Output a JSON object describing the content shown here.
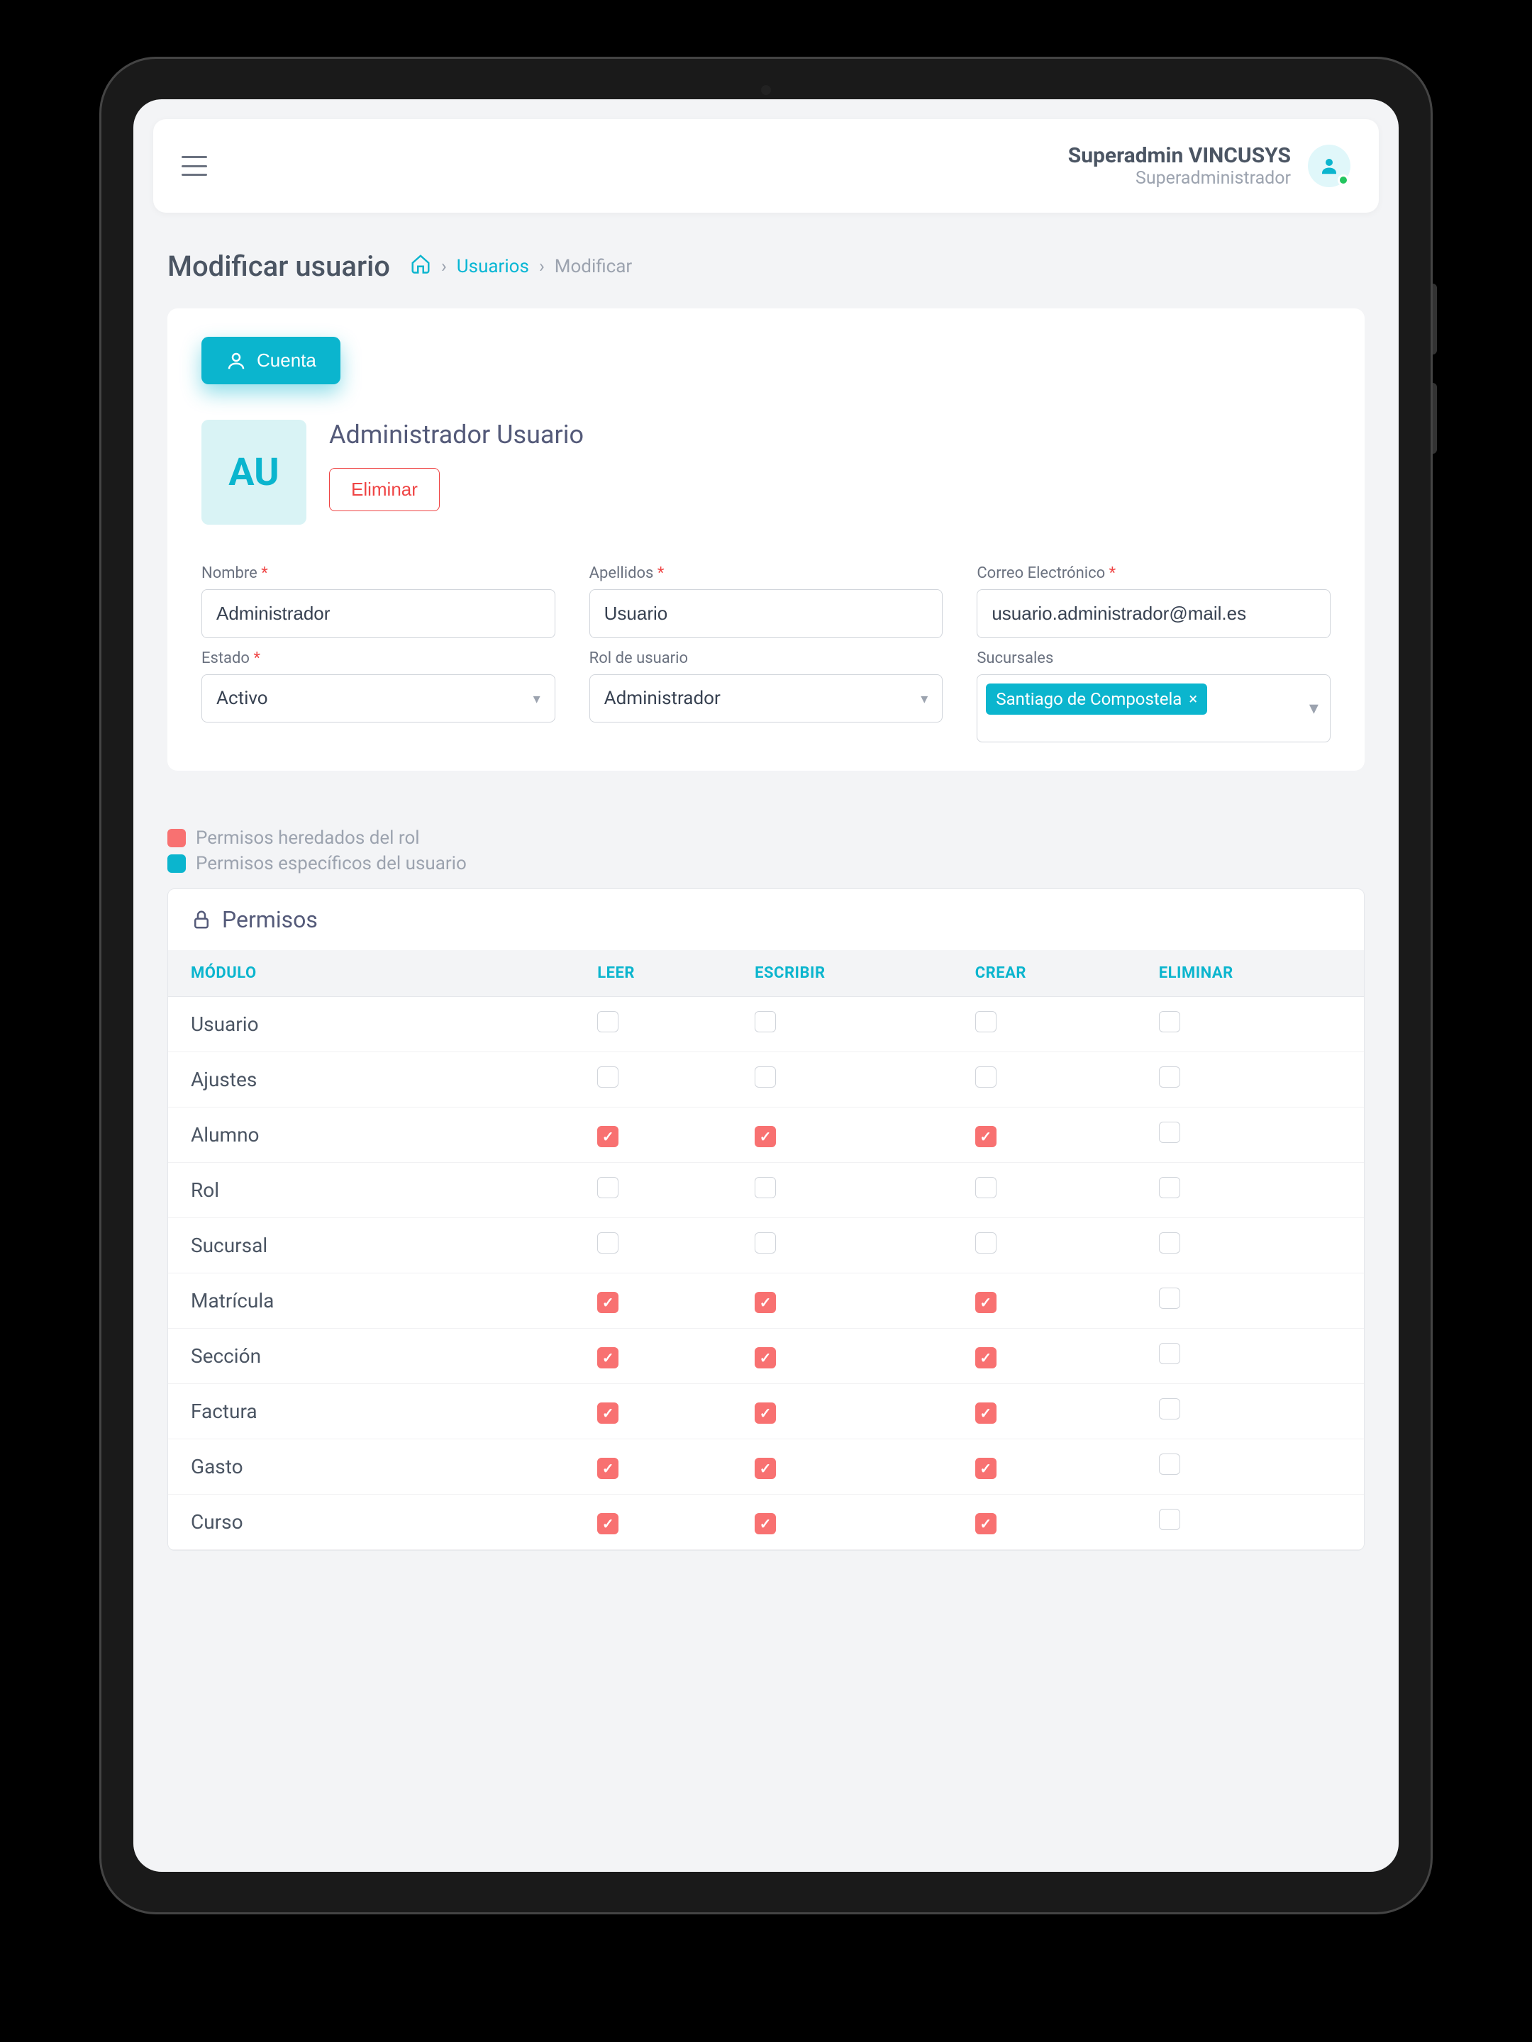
{
  "header": {
    "user_name": "Superadmin VINCUSYS",
    "user_role": "Superadministrador"
  },
  "page": {
    "title": "Modificar usuario",
    "breadcrumb_link": "Usuarios",
    "breadcrumb_current": "Modificar"
  },
  "tabs": {
    "cuenta": "Cuenta"
  },
  "profile": {
    "initials": "AU",
    "display_name": "Administrador Usuario",
    "delete_label": "Eliminar"
  },
  "form": {
    "nombre_label": "Nombre",
    "nombre_value": "Administrador",
    "apellidos_label": "Apellidos",
    "apellidos_value": "Usuario",
    "correo_label": "Correo Electrónico",
    "correo_value": "usuario.administrador@mail.es",
    "estado_label": "Estado",
    "estado_value": "Activo",
    "rol_label": "Rol de usuario",
    "rol_value": "Administrador",
    "sucursales_label": "Sucursales",
    "sucursal_tag": "Santiago de Compostela",
    "required_mark": "*"
  },
  "legend": {
    "inherited": "Permisos heredados del rol",
    "user_specific": "Permisos específicos del usuario"
  },
  "permissions": {
    "title": "Permisos",
    "columns": [
      "MÓDULO",
      "LEER",
      "ESCRIBIR",
      "CREAR",
      "ELIMINAR"
    ],
    "rows": [
      {
        "module": "Usuario",
        "leer": false,
        "escribir": false,
        "crear": false,
        "eliminar": false
      },
      {
        "module": "Ajustes",
        "leer": false,
        "escribir": false,
        "crear": false,
        "eliminar": false
      },
      {
        "module": "Alumno",
        "leer": true,
        "escribir": true,
        "crear": true,
        "eliminar": false
      },
      {
        "module": "Rol",
        "leer": false,
        "escribir": false,
        "crear": false,
        "eliminar": false
      },
      {
        "module": "Sucursal",
        "leer": false,
        "escribir": false,
        "crear": false,
        "eliminar": false
      },
      {
        "module": "Matrícula",
        "leer": true,
        "escribir": true,
        "crear": true,
        "eliminar": false
      },
      {
        "module": "Sección",
        "leer": true,
        "escribir": true,
        "crear": true,
        "eliminar": false
      },
      {
        "module": "Factura",
        "leer": true,
        "escribir": true,
        "crear": true,
        "eliminar": false
      },
      {
        "module": "Gasto",
        "leer": true,
        "escribir": true,
        "crear": true,
        "eliminar": false
      },
      {
        "module": "Curso",
        "leer": true,
        "escribir": true,
        "crear": true,
        "eliminar": false
      }
    ]
  },
  "colors": {
    "accent": "#0bb5ce",
    "danger": "#ef4444",
    "inherited_perm": "#f87171"
  }
}
